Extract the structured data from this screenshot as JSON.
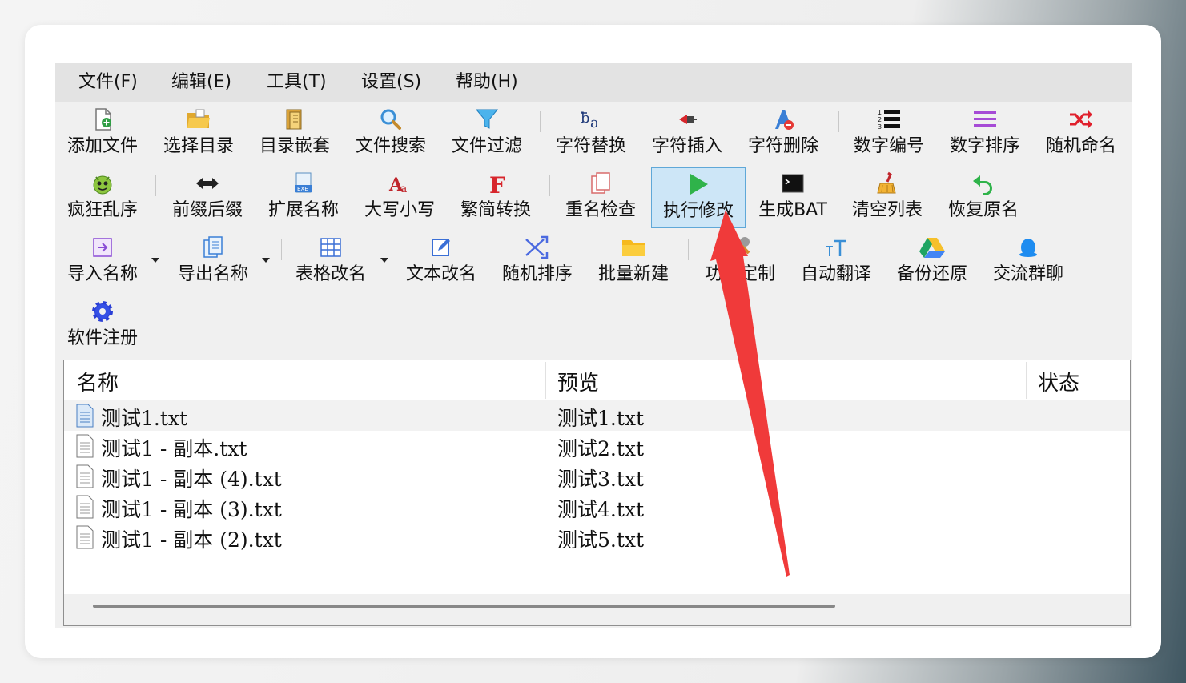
{
  "menu": [
    "文件(F)",
    "编辑(E)",
    "工具(T)",
    "设置(S)",
    "帮助(H)"
  ],
  "toolbar": {
    "row1": [
      "添加文件",
      "选择目录",
      "目录嵌套",
      "文件搜索",
      "文件过滤",
      "字符替换",
      "字符插入",
      "字符删除",
      "数字编号",
      "数字排序",
      "随机命名"
    ],
    "row2": [
      "疯狂乱序",
      "前缀后缀",
      "扩展名称",
      "大写小写",
      "繁简转换",
      "重名检查",
      "执行修改",
      "生成BAT",
      "清空列表",
      "恢复原名"
    ],
    "row3": [
      "导入名称",
      "导出名称",
      "表格改名",
      "文本改名",
      "随机排序",
      "批量新建",
      "功能定制",
      "自动翻译",
      "备份还原",
      "交流群聊"
    ],
    "row4": [
      "软件注册"
    ],
    "active": "执行修改"
  },
  "list": {
    "columns": [
      "名称",
      "预览",
      "状态"
    ],
    "rows": [
      {
        "name": "测试1.txt",
        "preview": "测试1.txt",
        "status": ""
      },
      {
        "name": "测试1 - 副本.txt",
        "preview": "测试2.txt",
        "status": ""
      },
      {
        "name": "测试1 - 副本 (4).txt",
        "preview": "测试3.txt",
        "status": ""
      },
      {
        "name": "测试1 - 副本 (3).txt",
        "preview": "测试4.txt",
        "status": ""
      },
      {
        "name": "测试1 - 副本 (2).txt",
        "preview": "测试5.txt",
        "status": ""
      }
    ]
  },
  "colors": {
    "annotation_arrow": "#f03a3a",
    "active_button": "#cde6f7",
    "menubar": "#e3e3e3"
  }
}
